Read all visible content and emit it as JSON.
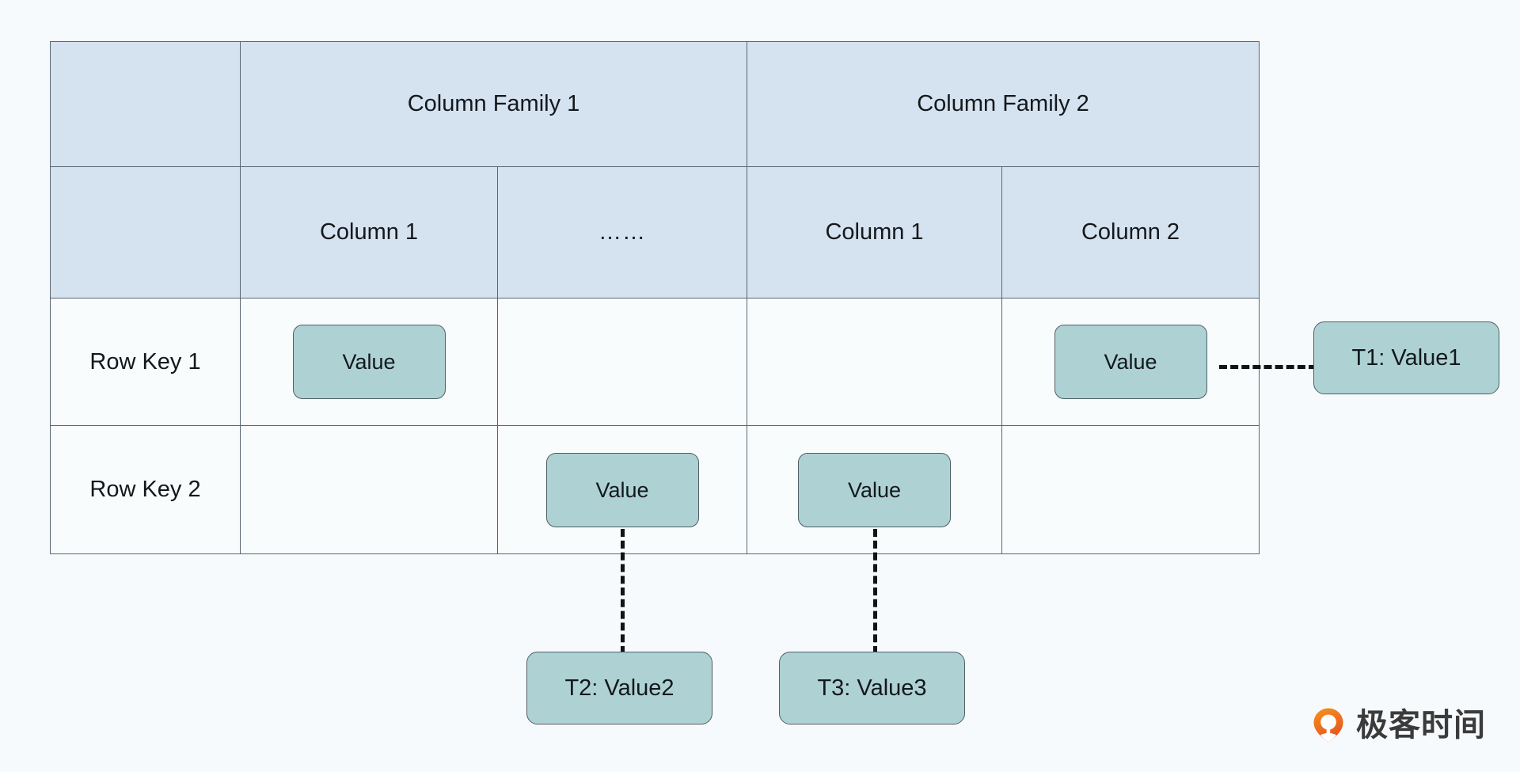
{
  "diagram": {
    "title": "HBase logical data model table",
    "colors": {
      "background": "#f7fafc",
      "header_fill": "#d5e2f0",
      "cell_fill": "#f9fcfd",
      "border": "#5a6670",
      "value_chip_fill": "#aed2d4",
      "value_chip_border": "#4f5f66",
      "connector": "#111417",
      "brand_accent": "#ef7b21"
    }
  },
  "table": {
    "family_header": {
      "corner_label": "",
      "families": [
        {
          "label": "Column Family 1",
          "span": 2
        },
        {
          "label": "Column Family 2",
          "span": 2
        }
      ]
    },
    "column_header": {
      "corner_label": "",
      "columns": [
        {
          "label": "Column 1"
        },
        {
          "label": "……"
        },
        {
          "label": "Column 1"
        },
        {
          "label": "Column 2"
        }
      ]
    },
    "rows": [
      {
        "row_key": "Row Key 1",
        "cells": [
          {
            "value": "Value",
            "filled": true
          },
          {
            "value": "",
            "filled": false
          },
          {
            "value": "",
            "filled": false
          },
          {
            "value": "Value",
            "filled": true
          }
        ]
      },
      {
        "row_key": "Row Key 2",
        "cells": [
          {
            "value": "",
            "filled": false
          },
          {
            "value": "Value",
            "filled": true
          },
          {
            "value": "Value",
            "filled": true
          },
          {
            "value": "",
            "filled": false
          }
        ]
      }
    ]
  },
  "timestamps": [
    {
      "id": "t1",
      "label": "T1: Value1"
    },
    {
      "id": "t2",
      "label": "T2: Value2"
    },
    {
      "id": "t3",
      "label": "T3: Value3"
    }
  ],
  "brand": {
    "name": "极客时间",
    "mark": "geektime-logo-icon"
  }
}
